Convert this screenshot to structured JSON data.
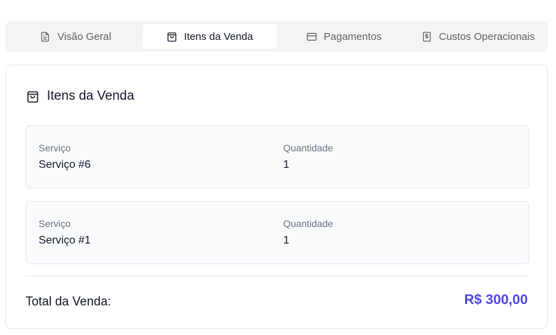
{
  "tabs": [
    {
      "label": "Visão Geral",
      "icon": "file-text-icon",
      "active": false
    },
    {
      "label": "Itens da Venda",
      "icon": "shopping-bag-icon",
      "active": true
    },
    {
      "label": "Pagamentos",
      "icon": "credit-card-icon",
      "active": false
    },
    {
      "label": "Custos Operacionais",
      "icon": "receipt-dollar-icon",
      "active": false
    }
  ],
  "card": {
    "title": "Itens da Venda",
    "title_icon": "shopping-bag-icon",
    "items": [
      {
        "service_label": "Serviço",
        "service_value": "Serviço #6",
        "qty_label": "Quantidade",
        "qty_value": "1"
      },
      {
        "service_label": "Serviço",
        "service_value": "Serviço #1",
        "qty_label": "Quantidade",
        "qty_value": "1"
      }
    ],
    "total_label": "Total da Venda:",
    "total_value": "R$ 300,00"
  },
  "colors": {
    "accent": "#4f46e5",
    "tab_bar_bg": "#f4f4f2",
    "item_bg": "#f8fafc",
    "border": "#e5e7eb"
  }
}
